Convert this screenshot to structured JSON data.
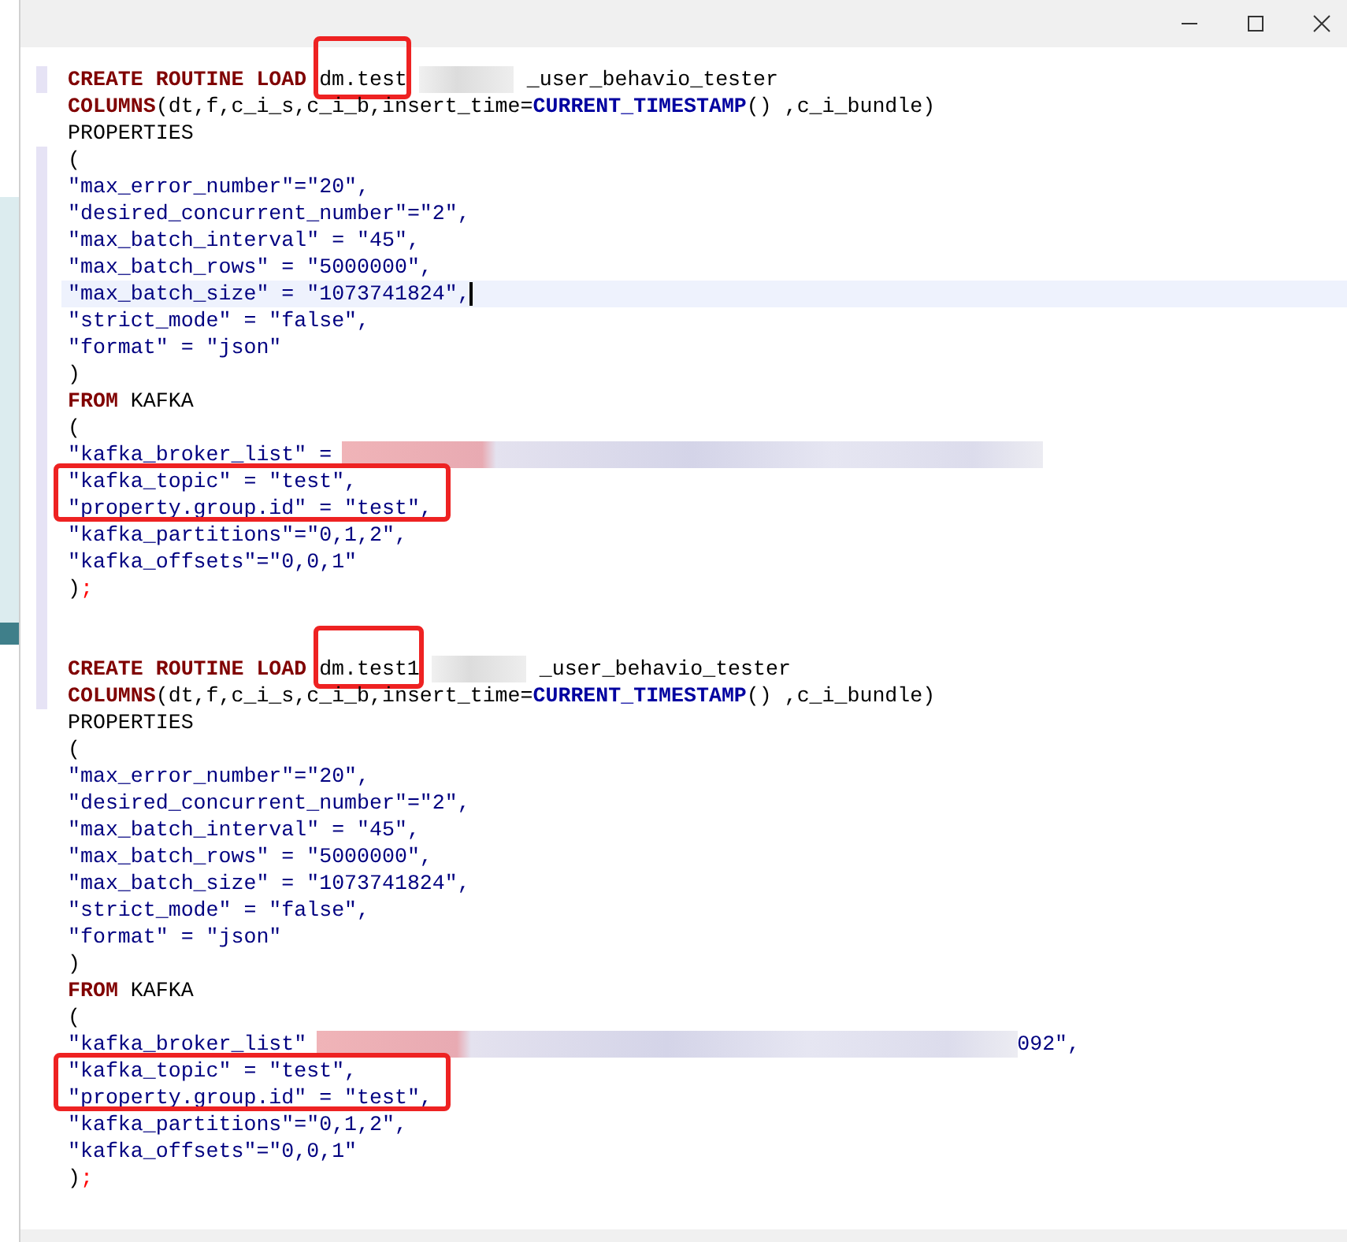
{
  "window": {
    "controls": [
      {
        "kind": "minimize"
      },
      {
        "kind": "maximize"
      },
      {
        "kind": "close"
      }
    ]
  },
  "code": [
    {
      "kind": "line",
      "changed": true,
      "current": false,
      "tokens": [
        {
          "kind": "kw",
          "text": "CREATE ROUTINE LOAD"
        },
        {
          "kind": "txt",
          "text": "dm.test",
          "boxed": true
        },
        {
          "kind": "redact-short"
        },
        {
          "kind": "txt",
          "text": "_user_behavio_tester"
        }
      ]
    },
    {
      "kind": "line",
      "changed": false,
      "current": false,
      "tokens": [
        {
          "kind": "kw",
          "text": "COLUMNS"
        },
        {
          "kind": "txt",
          "text": "(dt,f,c_i_s,c_i_b,insert_time="
        },
        {
          "kind": "fn",
          "text": "CURRENT_TIMESTAMP"
        },
        {
          "kind": "txt",
          "text": "() ,c_i_bundle)"
        }
      ]
    },
    {
      "kind": "line",
      "changed": false,
      "current": false,
      "tokens": [
        {
          "kind": "txt",
          "text": "PROPERTIES"
        }
      ]
    },
    {
      "kind": "line",
      "changed": true,
      "current": false,
      "tokens": [
        {
          "kind": "txt",
          "text": "("
        }
      ]
    },
    {
      "kind": "line",
      "changed": true,
      "current": false,
      "tokens": [
        {
          "kind": "str",
          "text": "\"max_error_number\"=\"20\","
        }
      ]
    },
    {
      "kind": "line",
      "changed": true,
      "current": false,
      "tokens": [
        {
          "kind": "str",
          "text": "\"desired_concurrent_number\"=\"2\","
        }
      ]
    },
    {
      "kind": "line",
      "changed": true,
      "current": false,
      "tokens": [
        {
          "kind": "str",
          "text": "\"max_batch_interval\" = \"45\","
        }
      ]
    },
    {
      "kind": "line",
      "changed": true,
      "current": false,
      "tokens": [
        {
          "kind": "str",
          "text": "\"max_batch_rows\" = \"5000000\","
        }
      ]
    },
    {
      "kind": "line",
      "changed": true,
      "current": true,
      "tokens": [
        {
          "kind": "str",
          "text": "\"max_batch_size\" = \"1073741824\","
        }
      ]
    },
    {
      "kind": "line",
      "changed": true,
      "current": false,
      "tokens": [
        {
          "kind": "str",
          "text": "\"strict_mode\" = \"false\","
        }
      ]
    },
    {
      "kind": "line",
      "changed": true,
      "current": false,
      "tokens": [
        {
          "kind": "str",
          "text": "\"format\" = \"json\""
        }
      ]
    },
    {
      "kind": "line",
      "changed": true,
      "current": false,
      "tokens": [
        {
          "kind": "txt",
          "text": ")"
        }
      ]
    },
    {
      "kind": "line",
      "changed": true,
      "current": false,
      "tokens": [
        {
          "kind": "kw",
          "text": "FROM"
        },
        {
          "kind": "txt",
          "text": " KAFKA"
        }
      ]
    },
    {
      "kind": "line",
      "changed": true,
      "current": false,
      "tokens": [
        {
          "kind": "txt",
          "text": "("
        }
      ]
    },
    {
      "kind": "line",
      "changed": true,
      "current": false,
      "tokens": [
        {
          "kind": "str",
          "text": "\"kafka_broker_list\" ="
        },
        {
          "kind": "redact-long"
        }
      ]
    },
    {
      "kind": "boxed",
      "lines": [
        {
          "kind": "line",
          "changed": true,
          "current": false,
          "tokens": [
            {
              "kind": "str",
              "text": "\"kafka_topic\" = \"test\","
            }
          ]
        },
        {
          "kind": "line",
          "changed": true,
          "current": false,
          "tokens": [
            {
              "kind": "str",
              "text": "\"property.group.id\" = \"test\","
            }
          ]
        }
      ]
    },
    {
      "kind": "line",
      "changed": true,
      "current": false,
      "tokens": [
        {
          "kind": "str",
          "text": "\"kafka_partitions\"=\"0,1,2\","
        }
      ]
    },
    {
      "kind": "line",
      "changed": true,
      "current": false,
      "tokens": [
        {
          "kind": "str",
          "text": "\"kafka_offsets\"=\"0,0,1\""
        }
      ]
    },
    {
      "kind": "line",
      "changed": true,
      "current": false,
      "tokens": [
        {
          "kind": "txt",
          "text": ")"
        },
        {
          "kind": "punct",
          "text": ";"
        }
      ]
    },
    {
      "kind": "blank",
      "changed": true
    },
    {
      "kind": "blank",
      "changed": true
    },
    {
      "kind": "line",
      "changed": true,
      "current": false,
      "tokens": [
        {
          "kind": "kw",
          "text": "CREATE ROUTINE LOAD"
        },
        {
          "kind": "txt",
          "text": "dm.test1",
          "boxed": true
        },
        {
          "kind": "redact-short"
        },
        {
          "kind": "txt",
          "text": "_user_behavio_tester"
        }
      ]
    },
    {
      "kind": "line",
      "changed": true,
      "current": false,
      "tokens": [
        {
          "kind": "kw",
          "text": "COLUMNS"
        },
        {
          "kind": "txt",
          "text": "(dt,f,c_i_s,c_i_b,insert_time="
        },
        {
          "kind": "fn",
          "text": "CURRENT_TIMESTAMP"
        },
        {
          "kind": "txt",
          "text": "() ,c_i_bundle)"
        }
      ]
    },
    {
      "kind": "line",
      "changed": false,
      "current": false,
      "tokens": [
        {
          "kind": "txt",
          "text": "PROPERTIES"
        }
      ]
    },
    {
      "kind": "line",
      "changed": false,
      "current": false,
      "tokens": [
        {
          "kind": "txt",
          "text": "("
        }
      ]
    },
    {
      "kind": "line",
      "changed": false,
      "current": false,
      "tokens": [
        {
          "kind": "str",
          "text": "\"max_error_number\"=\"20\","
        }
      ]
    },
    {
      "kind": "line",
      "changed": false,
      "current": false,
      "tokens": [
        {
          "kind": "str",
          "text": "\"desired_concurrent_number\"=\"2\","
        }
      ]
    },
    {
      "kind": "line",
      "changed": false,
      "current": false,
      "tokens": [
        {
          "kind": "str",
          "text": "\"max_batch_interval\" = \"45\","
        }
      ]
    },
    {
      "kind": "line",
      "changed": false,
      "current": false,
      "tokens": [
        {
          "kind": "str",
          "text": "\"max_batch_rows\" = \"5000000\","
        }
      ]
    },
    {
      "kind": "line",
      "changed": false,
      "current": false,
      "tokens": [
        {
          "kind": "str",
          "text": "\"max_batch_size\" = \"1073741824\","
        }
      ]
    },
    {
      "kind": "line",
      "changed": false,
      "current": false,
      "tokens": [
        {
          "kind": "str",
          "text": "\"strict_mode\" = \"false\","
        }
      ]
    },
    {
      "kind": "line",
      "changed": false,
      "current": false,
      "tokens": [
        {
          "kind": "str",
          "text": "\"format\" = \"json\""
        }
      ]
    },
    {
      "kind": "line",
      "changed": false,
      "current": false,
      "tokens": [
        {
          "kind": "txt",
          "text": ")"
        }
      ]
    },
    {
      "kind": "line",
      "changed": false,
      "current": false,
      "tokens": [
        {
          "kind": "kw",
          "text": "FROM"
        },
        {
          "kind": "txt",
          "text": " KAFKA"
        }
      ]
    },
    {
      "kind": "line",
      "changed": false,
      "current": false,
      "tokens": [
        {
          "kind": "txt",
          "text": "("
        }
      ]
    },
    {
      "kind": "line",
      "changed": false,
      "current": false,
      "tokens": [
        {
          "kind": "str",
          "text": "\"kafka_broker_list\""
        },
        {
          "kind": "redact-long"
        },
        {
          "kind": "str",
          "text": "092\","
        }
      ]
    },
    {
      "kind": "boxed",
      "lines": [
        {
          "kind": "line",
          "changed": false,
          "current": false,
          "tokens": [
            {
              "kind": "str",
              "text": "\"kafka_topic\" = \"test\","
            }
          ]
        },
        {
          "kind": "line",
          "changed": false,
          "current": false,
          "tokens": [
            {
              "kind": "str",
              "text": "\"property.group.id\" = \"test\","
            }
          ]
        }
      ]
    },
    {
      "kind": "line",
      "changed": false,
      "current": false,
      "tokens": [
        {
          "kind": "str",
          "text": "\"kafka_partitions\"=\"0,1,2\","
        }
      ]
    },
    {
      "kind": "line",
      "changed": false,
      "current": false,
      "tokens": [
        {
          "kind": "str",
          "text": "\"kafka_offsets\"=\"0,0,1\""
        }
      ]
    },
    {
      "kind": "line",
      "changed": false,
      "current": false,
      "tokens": [
        {
          "kind": "txt",
          "text": ")"
        },
        {
          "kind": "punct",
          "text": ";"
        }
      ]
    }
  ]
}
